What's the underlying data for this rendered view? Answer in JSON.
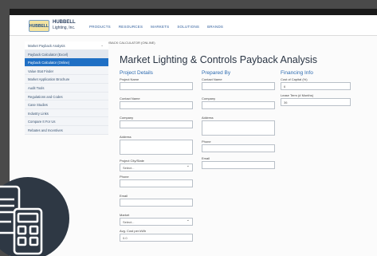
{
  "brand": {
    "logo_mark": "HUBBELL",
    "name_line1": "HUBBELL",
    "name_line2": "Lighting, Inc."
  },
  "nav": [
    "PRODUCTS",
    "RESOURCES",
    "MARKETS",
    "SOLUTIONS",
    "BRANDS"
  ],
  "breadcrumb": {
    "items": [
      "HUBBELL LIGHTING",
      "CALCULATORS"
    ],
    "current": "PAYBACK CALCULATOR (ONLINE)"
  },
  "sidebar": [
    {
      "label": "Market Payback Analysis",
      "state": "head"
    },
    {
      "label": "Payback Calculator (Excel)",
      "state": "sub"
    },
    {
      "label": "Payback Calculator (Online)",
      "state": "active"
    },
    {
      "label": "Value Stat Finder",
      "state": "normal"
    },
    {
      "label": "Market Application Brochure",
      "state": "normal"
    },
    {
      "label": "Audit Tools",
      "state": "normal"
    },
    {
      "label": "Regulations and Codes",
      "state": "normal"
    },
    {
      "label": "Case Studies",
      "state": "normal"
    },
    {
      "label": "Industry Links",
      "state": "normal"
    },
    {
      "label": "Compare It For Us",
      "state": "normal"
    },
    {
      "label": "Rebates and Incentives",
      "state": "normal"
    }
  ],
  "page_title": "Market Lighting & Controls Payback Analysis",
  "project": {
    "heading": "Project Details",
    "fields": [
      {
        "label": "Project Name",
        "value": ""
      },
      {
        "label": "Contact Name",
        "value": ""
      },
      {
        "label": "Company",
        "value": ""
      },
      {
        "label": "Address",
        "value": ""
      },
      {
        "label": "Project City/State",
        "value": "Select..."
      },
      {
        "label": "Phone",
        "value": ""
      },
      {
        "label": "Email",
        "value": ""
      },
      {
        "label": "Market",
        "value": "Select..."
      },
      {
        "label": "Avg. Cost per kWh",
        "value": "0.0"
      }
    ]
  },
  "prepared": {
    "heading": "Prepared By",
    "fields": [
      {
        "label": "Contact Name",
        "value": ""
      },
      {
        "label": "Company",
        "value": ""
      },
      {
        "label": "Address",
        "value": ""
      },
      {
        "label": "Phone",
        "value": ""
      },
      {
        "label": "Email",
        "value": ""
      }
    ]
  },
  "financing": {
    "heading": "Financing Info",
    "fields": [
      {
        "label": "Cost of Capital (%)",
        "value": "6"
      },
      {
        "label": "Lease Term (# Months)",
        "value": "36"
      }
    ]
  },
  "badge_icon": "calculator-icon",
  "colors": {
    "accent": "#1f6fc4",
    "dark": "#2e3844",
    "link": "#2d6bb0"
  }
}
